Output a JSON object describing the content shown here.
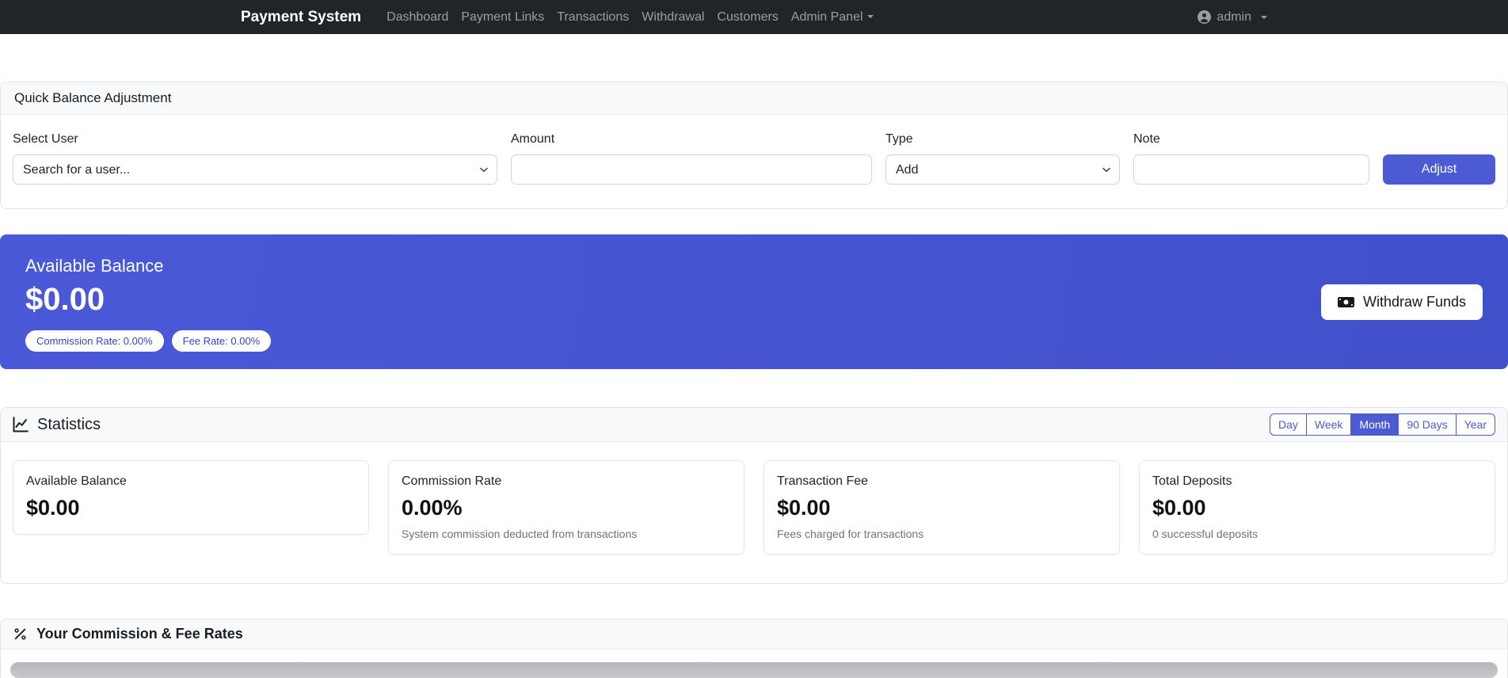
{
  "navbar": {
    "brand": "Payment System",
    "items": [
      "Dashboard",
      "Payment Links",
      "Transactions",
      "Withdrawal",
      "Customers"
    ],
    "admin_panel_label": "Admin Panel",
    "user_label": "admin"
  },
  "quick_adjustment": {
    "title": "Quick Balance Adjustment",
    "select_user_label": "Select User",
    "select_user_value": "Search for a user...",
    "amount_label": "Amount",
    "amount_value": "",
    "type_label": "Type",
    "type_value": "Add",
    "note_label": "Note",
    "note_value": "",
    "submit_label": "Adjust"
  },
  "balance_banner": {
    "title": "Available Balance",
    "amount": "$0.00",
    "commission_badge": "Commission Rate: 0.00%",
    "fee_badge": "Fee Rate: 0.00%",
    "withdraw_label": "Withdraw Funds"
  },
  "statistics": {
    "title": "Statistics",
    "periods": [
      {
        "label": "Day",
        "active": false
      },
      {
        "label": "Week",
        "active": false
      },
      {
        "label": "Month",
        "active": true
      },
      {
        "label": "90 Days",
        "active": false
      },
      {
        "label": "Year",
        "active": false
      }
    ],
    "cards": [
      {
        "label": "Available Balance",
        "value": "$0.00",
        "subtitle": ""
      },
      {
        "label": "Commission Rate",
        "value": "0.00%",
        "subtitle": "System commission deducted from transactions"
      },
      {
        "label": "Transaction Fee",
        "value": "$0.00",
        "subtitle": "Fees charged for transactions"
      },
      {
        "label": "Total Deposits",
        "value": "$0.00",
        "subtitle": "0 successful deposits"
      }
    ]
  },
  "rates_section": {
    "title": "Your Commission & Fee Rates"
  },
  "icons": {
    "user": "person-circle",
    "dropdown": "caret-down",
    "select": "chevron-down",
    "statistics": "graph-up",
    "withdraw": "cash",
    "rates": "percent"
  },
  "colors": {
    "accent": "#4c5bd4",
    "navbar_bg": "#212529",
    "card_header_bg": "#f8f9fa",
    "banner_gradient_start": "#4a59d8",
    "banner_gradient_end": "#4150ca",
    "badge_text": "#3445c8",
    "muted_text": "#6c757d",
    "border": "#e2e5e8"
  }
}
